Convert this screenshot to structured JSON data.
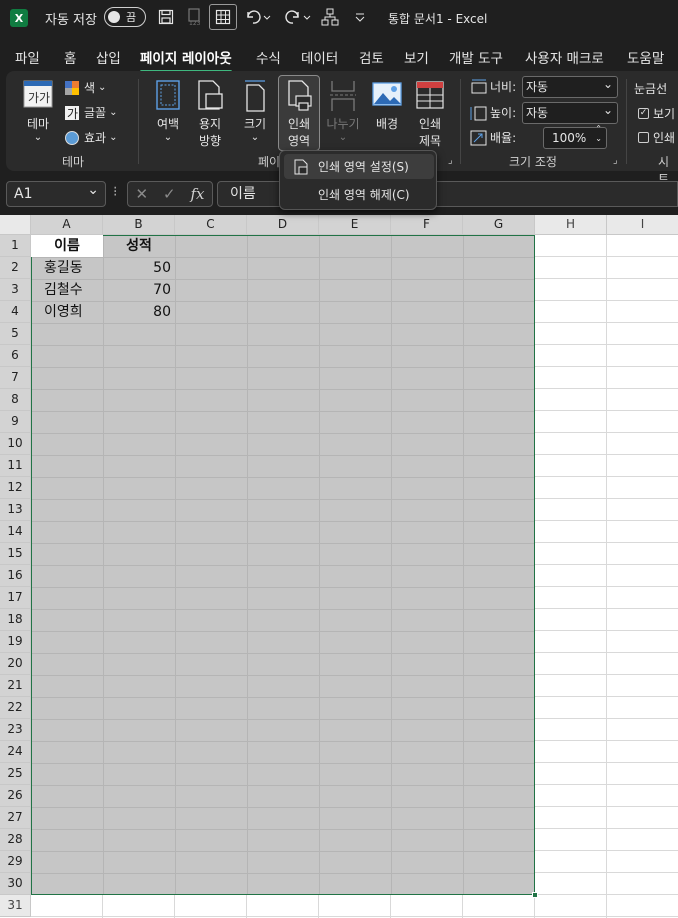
{
  "titlebar": {
    "app_icon_letter": "X",
    "autosave_label": "자동 저장",
    "autosave_state": "끔",
    "doc_title": "통합 문서1  -  Excel"
  },
  "tabs": [
    "파일",
    "홈",
    "삽입",
    "페이지 레이아웃",
    "수식",
    "데이터",
    "검토",
    "보기",
    "개발 도구",
    "사용자 매크로",
    "도움말"
  ],
  "active_tab": "페이지 레이아웃",
  "ribbon": {
    "theme": {
      "label": "테마",
      "colors": "색",
      "fonts": "글꼴",
      "effects": "효과",
      "group_label": "테마"
    },
    "page_setup": {
      "margins": "여백",
      "orientation_1": "용지",
      "orientation_2": "방향",
      "size": "크기",
      "print_area_1": "인쇄",
      "print_area_2": "영역",
      "breaks": "나누기",
      "background": "배경",
      "print_titles_1": "인쇄",
      "print_titles_2": "제목",
      "group_label": "페이"
    },
    "scale": {
      "width_label": "너비:",
      "width_value": "자동",
      "height_label": "높이:",
      "height_value": "자동",
      "scale_label": "배율:",
      "scale_value": "100%",
      "group_label": "크기 조정"
    },
    "sheet_options": {
      "gridlines": "눈금선",
      "view": "보기",
      "print": "인쇄",
      "group_label": "시트"
    }
  },
  "print_area_menu": {
    "set": "인쇄 영역 설정(S)",
    "clear": "인쇄 영역 해제(C)"
  },
  "formula_bar": {
    "name_box": "A1",
    "fx": "fx",
    "formula": "이름"
  },
  "columns": [
    "A",
    "B",
    "C",
    "D",
    "E",
    "F",
    "G",
    "H",
    "I"
  ],
  "rows": [
    "1",
    "2",
    "3",
    "4",
    "5",
    "6",
    "7",
    "8",
    "9",
    "10",
    "11",
    "12",
    "13",
    "14",
    "15",
    "16",
    "17",
    "18",
    "19",
    "20",
    "21",
    "22",
    "23",
    "24",
    "25",
    "26",
    "27",
    "28",
    "29",
    "30",
    "31"
  ],
  "sheet": {
    "header_name": "이름",
    "header_score": "성적",
    "records": [
      {
        "name": "홍길동",
        "score": "50"
      },
      {
        "name": "김철수",
        "score": "70"
      },
      {
        "name": "이영희",
        "score": "80"
      }
    ]
  },
  "colors": {
    "accent": "#3fb87f",
    "excel_green": "#217346",
    "selection_fill": "#c6c6c6"
  }
}
